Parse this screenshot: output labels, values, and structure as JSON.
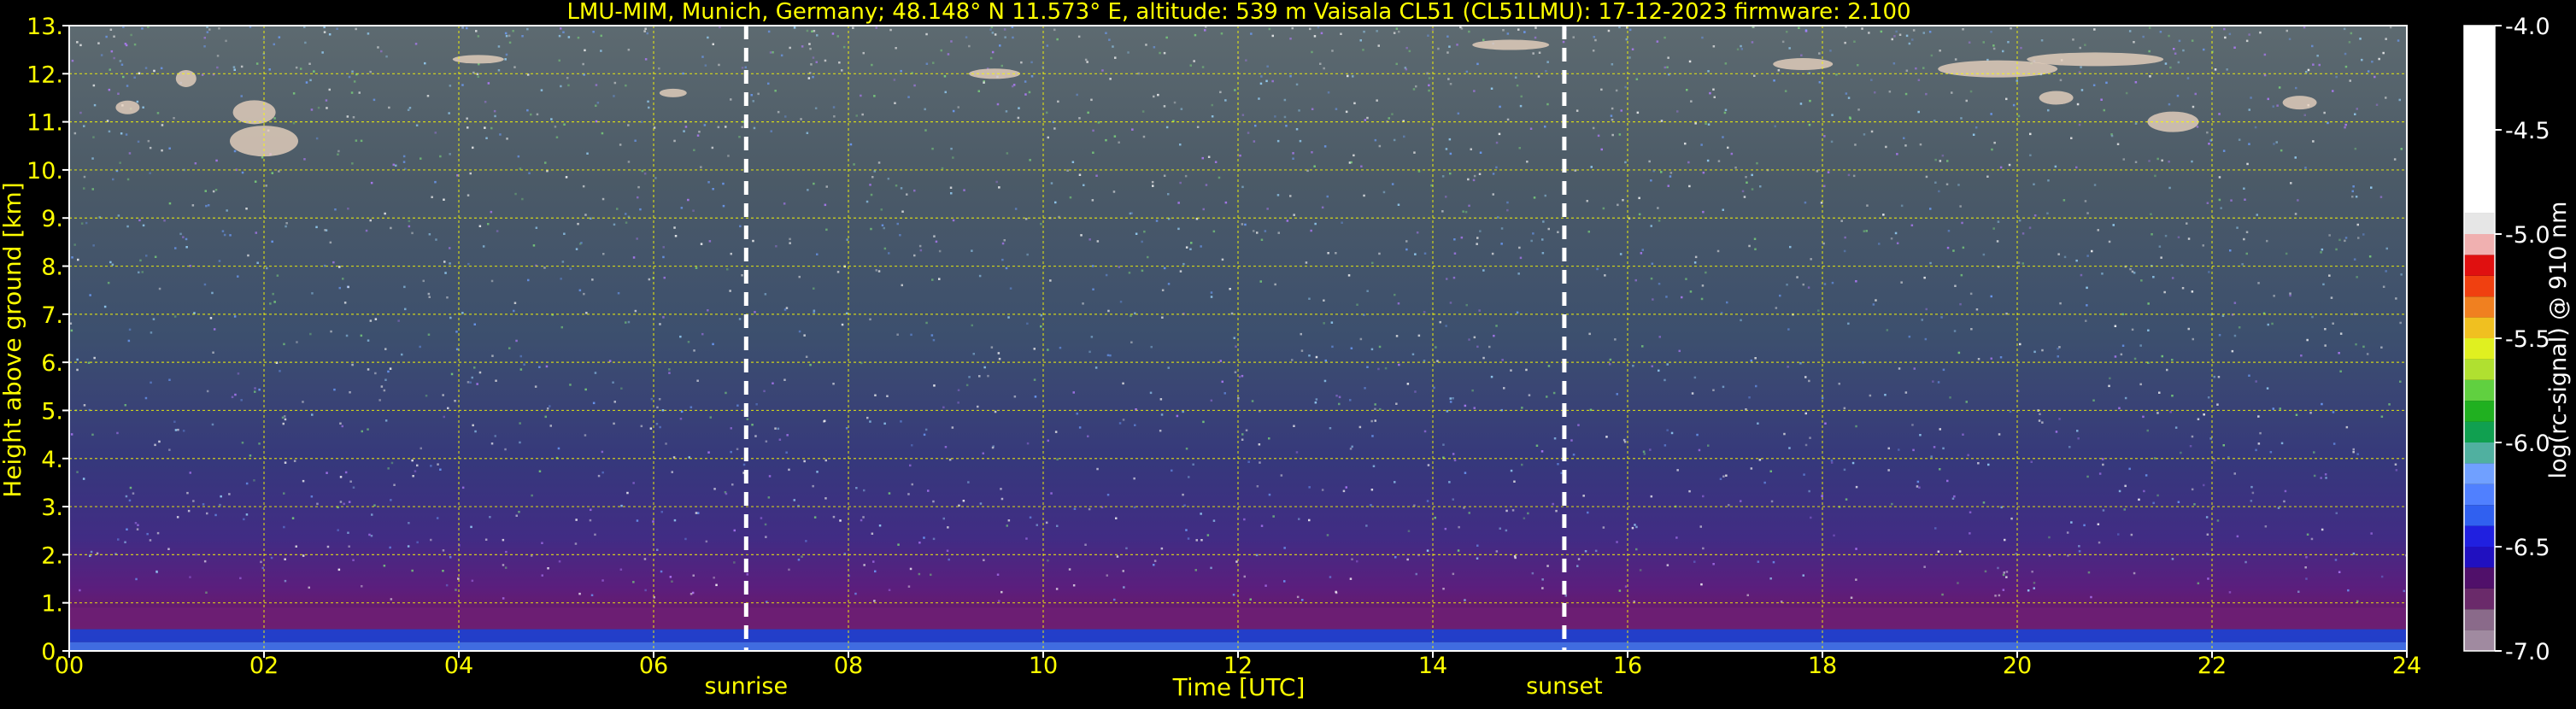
{
  "chart_data": {
    "type": "heatmap",
    "title": "LMU-MIM, Munich, Germany; 48.148° N 11.573° E, altitude: 539 m    Vaisala CL51 (CL51LMU): 17-12-2023    firmware: 2.100",
    "xlabel": "Time [UTC]",
    "ylabel": "Height above ground [km]",
    "xlim": [
      0,
      24
    ],
    "ylim": [
      0,
      13
    ],
    "x_ticks": [
      0,
      2,
      4,
      6,
      8,
      10,
      12,
      14,
      16,
      18,
      20,
      22,
      24
    ],
    "x_tick_labels": [
      "00",
      "02",
      "04",
      "06",
      "08",
      "10",
      "12",
      "14",
      "16",
      "18",
      "20",
      "22",
      "24"
    ],
    "y_ticks": [
      0,
      1,
      2,
      3,
      4,
      5,
      6,
      7,
      8,
      9,
      10,
      11,
      12,
      13
    ],
    "y_tick_labels": [
      "0.",
      "1.",
      "2.",
      "3.",
      "4.",
      "5.",
      "6.",
      "7.",
      "8.",
      "9.",
      "10.",
      "11.",
      "12.",
      "13."
    ],
    "grid": true,
    "grid_color": "#ffff00",
    "colorbar": {
      "label": "log(rc-signal) @ 910 nm",
      "range": [
        -7.0,
        -4.0
      ],
      "ticks": [
        -4.0,
        -4.5,
        -5.0,
        -5.5,
        -6.0,
        -6.5,
        -7.0
      ],
      "tick_labels": [
        "-4.0",
        "-4.5",
        "-5.0",
        "-5.5",
        "-6.0",
        "-6.5",
        "-7.0"
      ]
    },
    "annotations": [
      {
        "label": "sunrise",
        "x": 6.95
      },
      {
        "label": "sunset",
        "x": 15.35
      }
    ],
    "text_color": "#ffff00",
    "background": "#000000"
  }
}
